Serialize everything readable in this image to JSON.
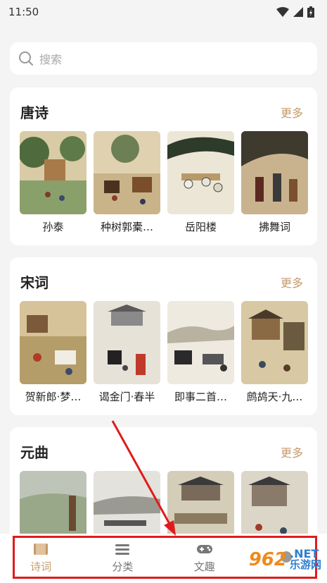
{
  "status": {
    "time": "11:50"
  },
  "search": {
    "placeholder": "搜索"
  },
  "sections": [
    {
      "title": "唐诗",
      "more": "更多",
      "items": [
        "孙泰",
        "种树郭橐…",
        "岳阳楼",
        "拂舞词"
      ]
    },
    {
      "title": "宋词",
      "more": "更多",
      "items": [
        "贺新郎·梦…",
        "谒金门·春半",
        "即事二首…",
        "鹧鸪天·九…"
      ]
    },
    {
      "title": "元曲",
      "more": "更多",
      "items": [
        "",
        "",
        "",
        ""
      ]
    }
  ],
  "tabs": [
    {
      "label": "诗词",
      "icon": "book-icon",
      "active": true
    },
    {
      "label": "分类",
      "icon": "category-icon",
      "active": false
    },
    {
      "label": "文趣",
      "icon": "gamepad-icon",
      "active": false
    },
    {
      "label": "",
      "icon": "profile-icon",
      "active": false
    }
  ],
  "watermark": {
    "brand": "962",
    "suffix": ".NET",
    "sub": "乐游网"
  },
  "colors": {
    "accent": "#c49a6c",
    "highlight": "#e01b1b",
    "background": "#f4f4f5"
  }
}
